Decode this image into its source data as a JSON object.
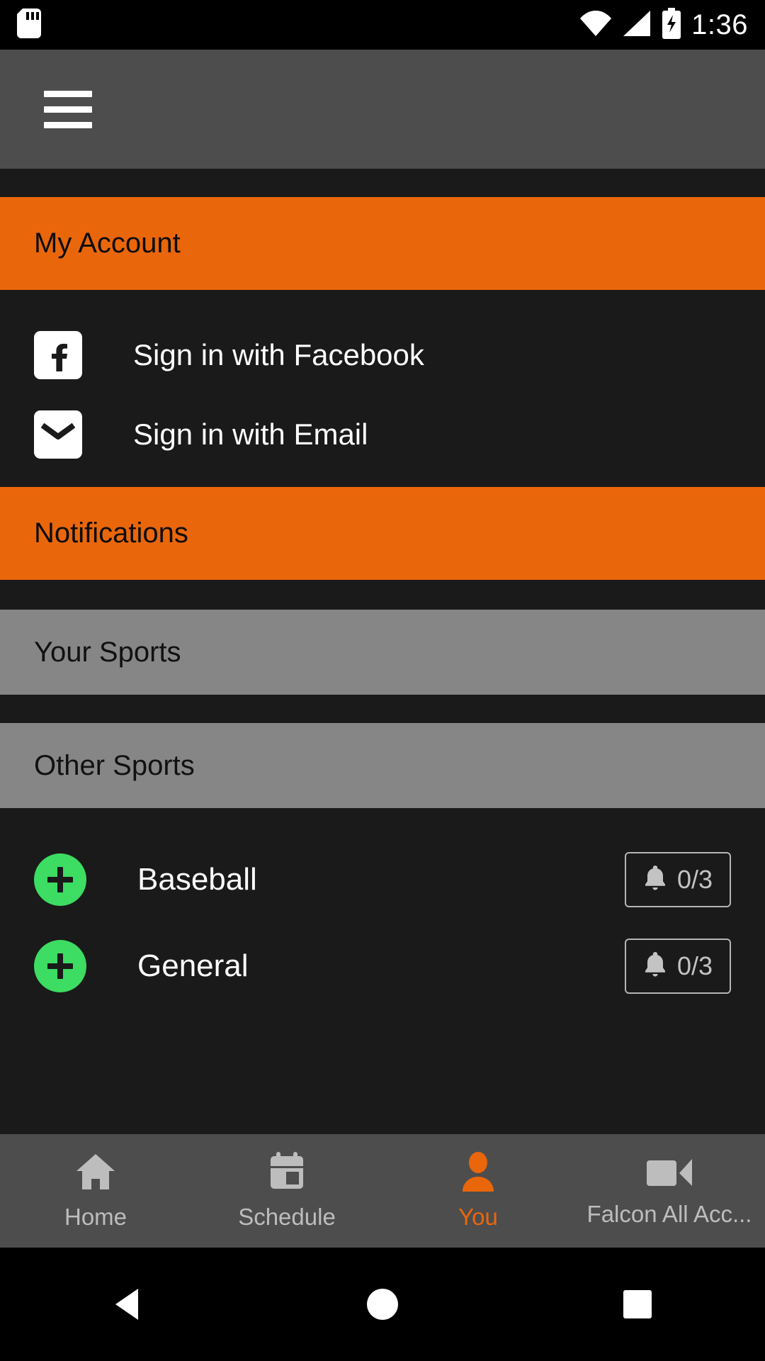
{
  "status_bar": {
    "time": "1:36",
    "icons": [
      "sd-card-icon",
      "wifi-icon",
      "cellular-signal-icon",
      "battery-charging-icon"
    ]
  },
  "app_bar": {
    "menu_icon": "hamburger-menu-icon"
  },
  "sections": {
    "my_account": {
      "label": "My Account"
    },
    "notifications": {
      "label": "Notifications"
    },
    "your_sports": {
      "label": "Your Sports"
    },
    "other_sports": {
      "label": "Other Sports"
    }
  },
  "sign_in": {
    "facebook": {
      "label": "Sign in with Facebook",
      "icon": "facebook-icon"
    },
    "email": {
      "label": "Sign in with Email",
      "icon": "email-icon"
    }
  },
  "sports": [
    {
      "name": "Baseball",
      "add_icon": "plus-icon",
      "notification_icon": "bell-icon",
      "notification_count": "0/3"
    },
    {
      "name": "General",
      "add_icon": "plus-icon",
      "notification_icon": "bell-icon",
      "notification_count": "0/3"
    }
  ],
  "bottom_nav": [
    {
      "label": "Home",
      "icon": "home-icon",
      "active": false
    },
    {
      "label": "Schedule",
      "icon": "calendar-icon",
      "active": false
    },
    {
      "label": "You",
      "icon": "person-icon",
      "active": true
    },
    {
      "label": "Falcon All Acc...",
      "icon": "video-camera-icon",
      "active": false
    }
  ],
  "android_nav": [
    {
      "label": "back",
      "icon": "back-triangle-icon"
    },
    {
      "label": "home",
      "icon": "home-circle-icon"
    },
    {
      "label": "recents",
      "icon": "recents-square-icon"
    }
  ],
  "colors": {
    "accent_orange": "#ea660b",
    "add_green": "#3ddc62",
    "section_gray": "#868686",
    "appbar_gray": "#4d4d4d",
    "background": "#1a1a1a"
  }
}
